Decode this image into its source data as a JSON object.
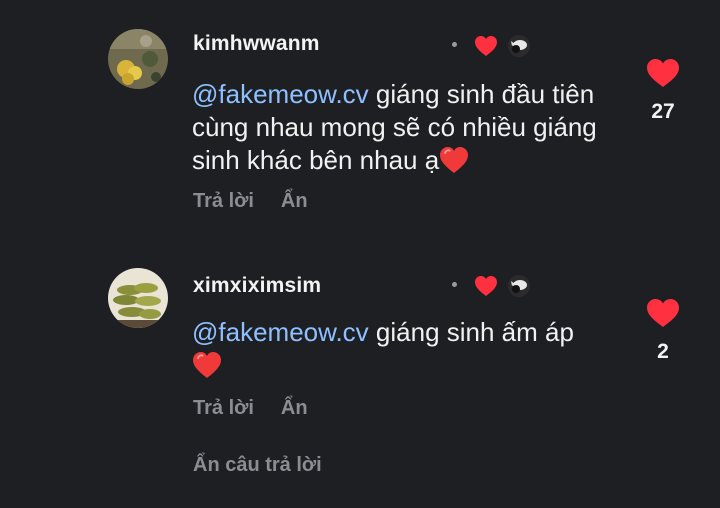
{
  "comments": [
    {
      "username": "kimhwwanm",
      "mention": "@fakemeow.cv",
      "text": " giáng sinh đầu tiên cùng nhau mong sẽ có nhiều giáng sinh khác bên nhau ạ",
      "trailing_emoji": "red-heart",
      "reply_label": "Trả lời",
      "hide_label": "Ẩn",
      "like_count": "27",
      "author_liked": true
    },
    {
      "username": "ximxiximsim",
      "mention": "@fakemeow.cv",
      "text": " giáng sinh ấm áp ",
      "trailing_emoji": "red-heart",
      "reply_label": "Trả lời",
      "hide_label": "Ẩn",
      "like_count": "2",
      "author_liked": true
    }
  ],
  "hide_replies_label": "Ẩn câu trả lời",
  "colors": {
    "background": "#1e1f23",
    "mention": "#8ec0ff",
    "heart": "#ff3040",
    "muted": "#8c8c92"
  }
}
